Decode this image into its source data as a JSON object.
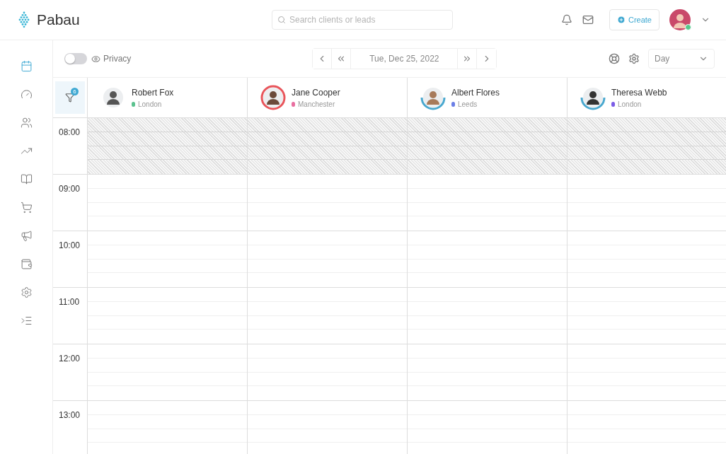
{
  "header": {
    "logo": "Pabau",
    "search": {
      "placeholder": "Search clients or leads"
    },
    "create_button": "Create",
    "user": {
      "online": true
    }
  },
  "sidebar": {
    "items": [
      {
        "selected": true
      },
      {
        "selected": false
      },
      {
        "selected": false
      },
      {
        "selected": false
      },
      {
        "selected": false
      },
      {
        "selected": false
      },
      {
        "selected": false
      },
      {
        "selected": false
      },
      {
        "selected": false
      },
      {
        "selected": false
      }
    ]
  },
  "toolbar": {
    "privacy": {
      "label": "Privacy",
      "on": false
    },
    "date": "Tue, Dec 25, 2022",
    "view": "Day"
  },
  "filter": {
    "badge": "6"
  },
  "staff": [
    {
      "name": "Robert Fox",
      "location": "London",
      "color": "#5cc28f",
      "kind": "plain"
    },
    {
      "name": "Jane Cooper",
      "location": "Manchester",
      "color": "#e86fa0",
      "kind": "alert"
    },
    {
      "name": "Albert Flores",
      "location": "Leeds",
      "color": "#6b7fe6",
      "kind": "progress"
    },
    {
      "name": "Theresa Webb",
      "location": "London",
      "color": "#7b5ce6",
      "kind": "progress"
    }
  ],
  "hours": [
    {
      "time": "08:00",
      "blocked": true
    },
    {
      "time": "09:00",
      "blocked": false
    },
    {
      "time": "10:00",
      "blocked": false
    },
    {
      "time": "11:00",
      "blocked": false
    },
    {
      "time": "12:00",
      "blocked": false
    },
    {
      "time": "13:00",
      "blocked": false
    }
  ]
}
